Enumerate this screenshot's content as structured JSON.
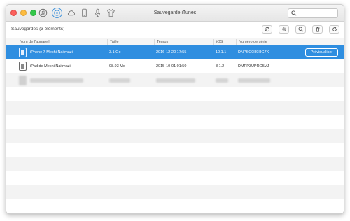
{
  "window": {
    "title": "Sauvegarde iTunes",
    "icons": [
      "music-icon",
      "backup-icon",
      "cloud-icon",
      "phone-icon",
      "microphone-icon",
      "tshirt-icon"
    ]
  },
  "search": {
    "placeholder": "",
    "value": ""
  },
  "toolbar": {
    "section_title": "Sauvegardes (3 éléments)",
    "tool_icons": [
      "sync-icon",
      "settings-icon",
      "search-icon",
      "trash-icon",
      "refresh-icon"
    ]
  },
  "table": {
    "columns": [
      "Nom de l'appareil",
      "Taille",
      "Temps",
      "iOS",
      "Numéro de série"
    ],
    "rows": [
      {
        "name": "iPhone 7 Mechi Naitmazi",
        "size": "3.1 Go",
        "time": "2016-12-20 17:55",
        "ios": "10.1.1",
        "serial": "DNPSC0H9HG7K",
        "action": "Prévisualiser",
        "selected": true
      },
      {
        "name": "iPad de Mechi Naitmazi",
        "size": "98.93 Mo",
        "time": "2015-10-01 01:50",
        "ios": "8.1.2",
        "serial": "DMPP3UPRG5VJ",
        "selected": false
      },
      {
        "name": "",
        "size": "",
        "time": "",
        "ios": "",
        "serial": "",
        "blurred": true
      }
    ]
  },
  "colors": {
    "accent": "#2f8ee0",
    "stripe": "#f3f3f3"
  }
}
